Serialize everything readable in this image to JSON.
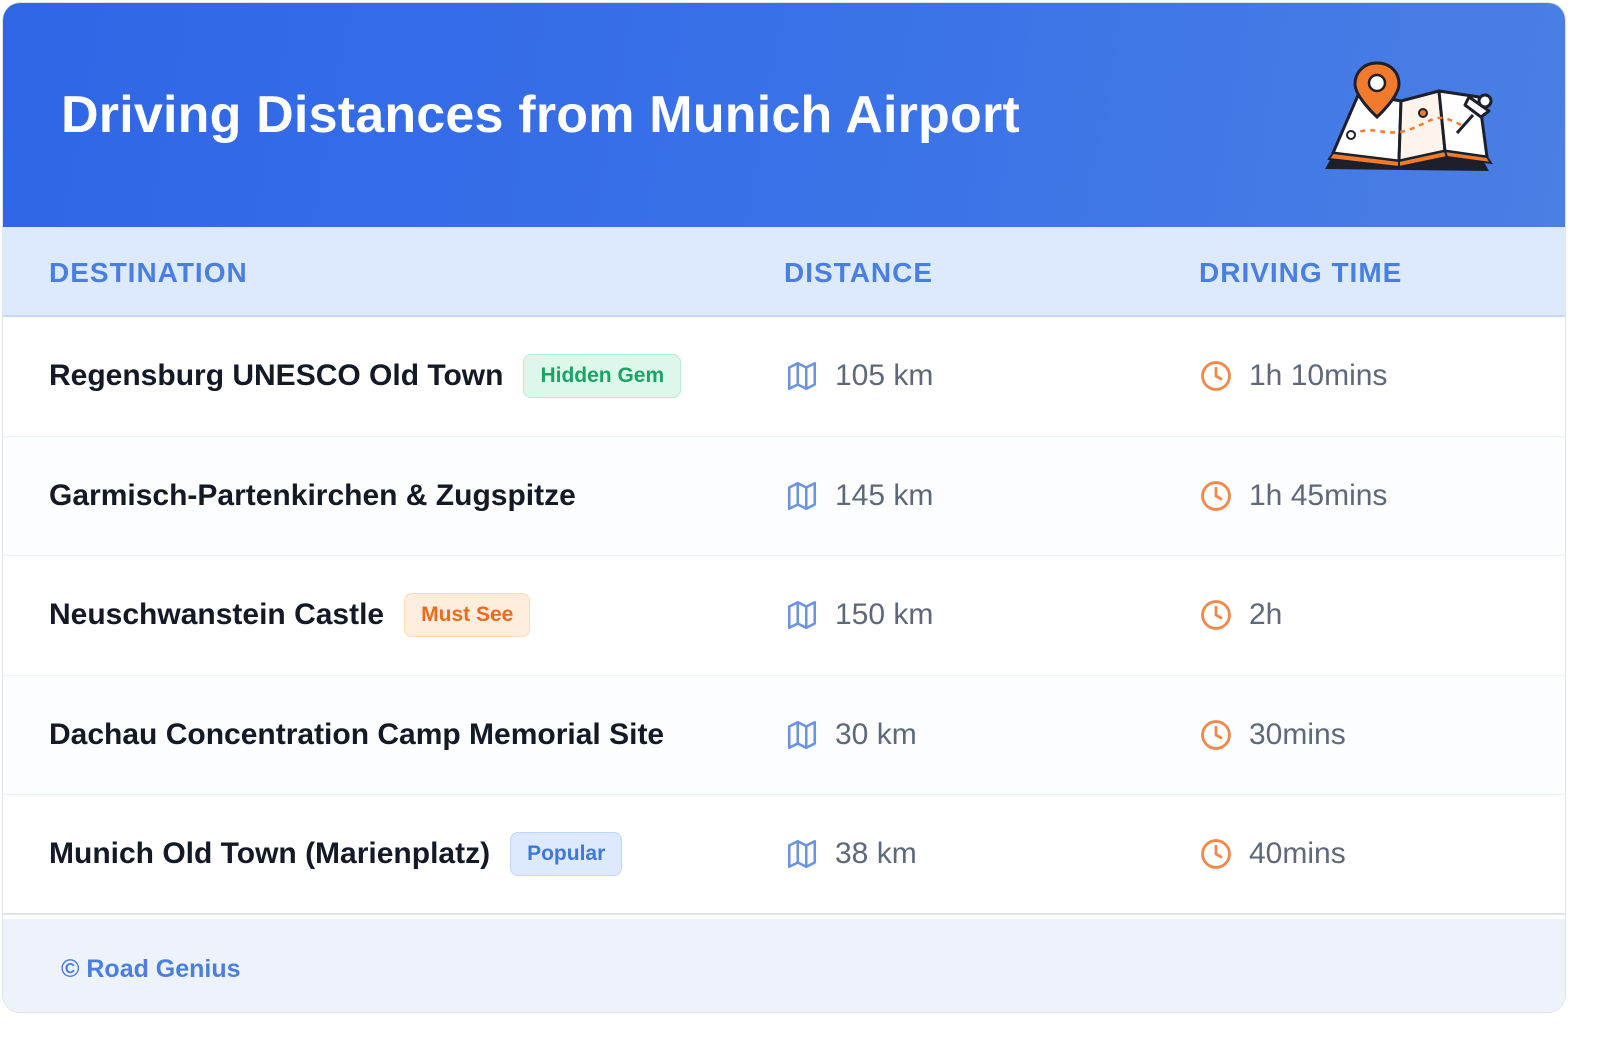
{
  "title": "Driving Distances from Munich Airport",
  "illustration_icon": "map-pin-illustration",
  "columns": {
    "destination": "DESTINATION",
    "distance": "DISTANCE",
    "time": "DRIVING TIME"
  },
  "rows": [
    {
      "destination": "Regensburg UNESCO Old Town",
      "badge": "Hidden Gem",
      "badge_color": "#1aa564",
      "distance": "105 km",
      "time": "1h 10mins"
    },
    {
      "destination": "Garmisch-Partenkirchen & Zugspitze",
      "badge": "",
      "distance": "145 km",
      "time": "1h 45mins"
    },
    {
      "destination": "Neuschwanstein Castle",
      "badge": "Must See",
      "badge_color": "#ef6a1c",
      "distance": "150 km",
      "time": "2h"
    },
    {
      "destination": "Dachau Concentration Camp Memorial Site",
      "badge": "",
      "distance": "30 km",
      "time": "30mins"
    },
    {
      "destination": "Munich Old Town (Marienplatz)",
      "badge": "Popular",
      "badge_color": "#3f78db",
      "distance": "38 km",
      "time": "40mins"
    }
  ],
  "icons": {
    "distance": "map-icon",
    "time": "clock-icon"
  },
  "colors": {
    "header": "#3a72e8",
    "accent": "#4a7fe0",
    "clock": "#f0894a"
  },
  "footer": "© Road Genius"
}
